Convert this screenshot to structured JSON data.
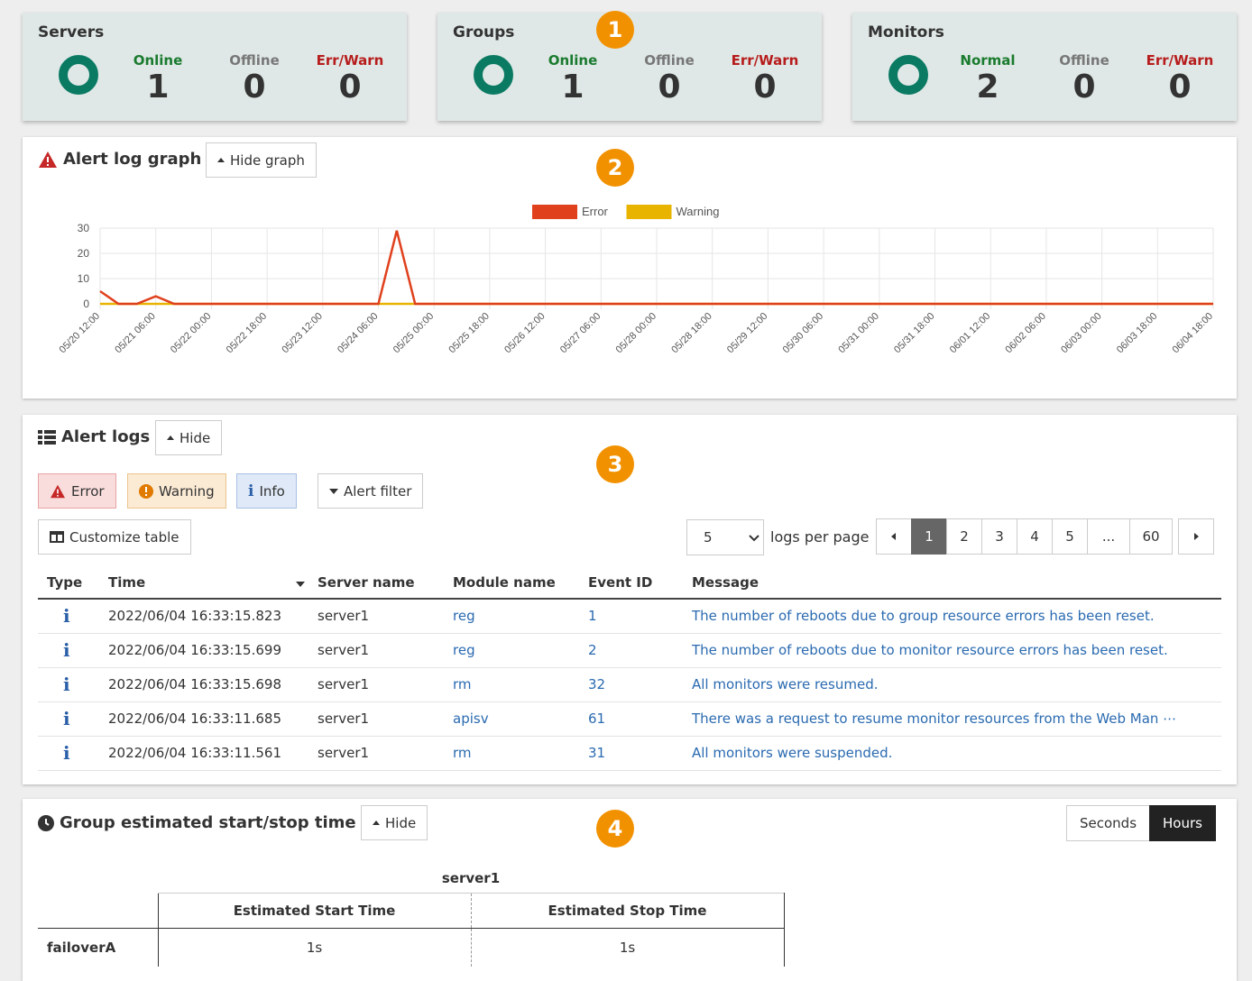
{
  "summary": {
    "servers": {
      "title": "Servers",
      "s1_label": "Online",
      "s1_value": "1",
      "s2_label": "Offline",
      "s2_value": "0",
      "s3_label": "Err/Warn",
      "s3_value": "0"
    },
    "groups": {
      "title": "Groups",
      "s1_label": "Online",
      "s1_value": "1",
      "s2_label": "Offline",
      "s2_value": "0",
      "s3_label": "Err/Warn",
      "s3_value": "0"
    },
    "monitors": {
      "title": "Monitors",
      "s1_label": "Normal",
      "s1_value": "2",
      "s2_label": "Offline",
      "s2_value": "0",
      "s3_label": "Err/Warn",
      "s3_value": "0"
    }
  },
  "badges": [
    "1",
    "2",
    "3",
    "4"
  ],
  "graph_panel": {
    "title": "Alert log graph",
    "toggle_label": "Hide graph"
  },
  "chart_data": {
    "type": "line",
    "x": [
      "05/20 12:00",
      "05/21 06:00",
      "05/22 00:00",
      "05/22 18:00",
      "05/23 12:00",
      "05/24 06:00",
      "05/25 00:00",
      "05/25 18:00",
      "05/26 12:00",
      "05/27 06:00",
      "05/28 00:00",
      "05/28 18:00",
      "05/29 12:00",
      "05/30 06:00",
      "05/31 00:00",
      "05/31 18:00",
      "06/01 12:00",
      "06/02 06:00",
      "06/03 00:00",
      "06/03 18:00",
      "06/04 18:00"
    ],
    "series": [
      {
        "name": "Error",
        "color": "#e0401c",
        "points": [
          [
            0,
            5
          ],
          [
            0.33,
            0
          ],
          [
            0.66,
            0
          ],
          [
            1,
            3
          ],
          [
            1.33,
            0
          ],
          [
            5,
            0
          ],
          [
            5.33,
            29
          ],
          [
            5.66,
            0
          ],
          [
            20,
            0
          ]
        ]
      },
      {
        "name": "Warning",
        "color": "#e8b400",
        "points": [
          [
            0,
            0
          ],
          [
            20,
            0
          ]
        ]
      }
    ],
    "yticks": [
      "0",
      "10",
      "20",
      "30"
    ],
    "ylim": [
      0,
      30
    ],
    "grid": true,
    "legend_position": "top-center"
  },
  "alert_panel": {
    "title": "Alert logs",
    "toggle_label": "Hide",
    "filters": {
      "error": "Error",
      "warning": "Warning",
      "info": "Info",
      "alert_filter": "Alert filter"
    },
    "customize_label": "Customize table",
    "per_page_value": "5",
    "per_page_label": "logs per page",
    "pages": [
      "1",
      "2",
      "3",
      "4",
      "5",
      "...",
      "60"
    ],
    "columns": {
      "type": "Type",
      "time": "Time",
      "server": "Server name",
      "module": "Module name",
      "event": "Event ID",
      "message": "Message"
    },
    "rows": [
      {
        "time": "2022/06/04 16:33:15.823",
        "server": "server1",
        "module": "reg",
        "event": "1",
        "message": "The number of reboots due to group resource errors has been reset."
      },
      {
        "time": "2022/06/04 16:33:15.699",
        "server": "server1",
        "module": "reg",
        "event": "2",
        "message": "The number of reboots due to monitor resource errors has been reset."
      },
      {
        "time": "2022/06/04 16:33:15.698",
        "server": "server1",
        "module": "rm",
        "event": "32",
        "message": "All monitors were resumed."
      },
      {
        "time": "2022/06/04 16:33:11.685",
        "server": "server1",
        "module": "apisv",
        "event": "61",
        "message": "There was a request to resume monitor resources from the Web Man ⋯"
      },
      {
        "time": "2022/06/04 16:33:11.561",
        "server": "server1",
        "module": "rm",
        "event": "31",
        "message": "All monitors were suspended."
      }
    ]
  },
  "estimate_panel": {
    "title": "Group estimated start/stop time",
    "toggle_label": "Hide",
    "unit_seconds": "Seconds",
    "unit_hours": "Hours",
    "server_header": "server1",
    "start_header": "Estimated Start Time",
    "stop_header": "Estimated Stop Time",
    "group": "failoverA",
    "start_value": "1s",
    "stop_value": "1s"
  }
}
